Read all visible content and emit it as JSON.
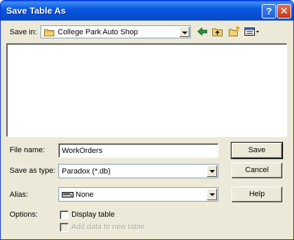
{
  "window": {
    "title": "Save Table As",
    "help_glyph": "?",
    "close_glyph": "✕"
  },
  "save_in": {
    "label": "Save in:",
    "value": "College Park Auto Shop",
    "icon": "folder-icon"
  },
  "toolbar": {
    "back_icon": "back-arrow-icon",
    "up_icon": "up-folder-icon",
    "new_folder_icon": "new-folder-icon",
    "view_menu_icon": "view-menu-icon"
  },
  "file_list": [],
  "file_name": {
    "label": "File name:",
    "value": "WorkOrders"
  },
  "save_as_type": {
    "label": "Save as type:",
    "value": "Paradox (*.db)"
  },
  "alias": {
    "label": "Alias:",
    "value": "None",
    "icon": "drive-icon"
  },
  "options": {
    "label": "Options:",
    "display_table": {
      "label": "Display table",
      "checked": false,
      "enabled": true
    },
    "add_data": {
      "label": "Add data to new table",
      "checked": false,
      "enabled": false
    }
  },
  "buttons": {
    "save": "Save",
    "cancel": "Cancel",
    "help": "Help"
  },
  "colors": {
    "titlebar": "#0b59e0",
    "dialog_bg": "#ece9d8",
    "folder_yellow": "#f5d26b",
    "arrow_green": "#1f9a3a",
    "disabled_text": "#aca899"
  }
}
